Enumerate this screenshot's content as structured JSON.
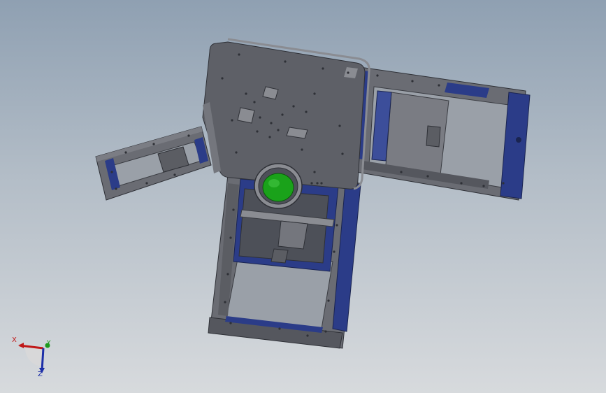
{
  "viewport": {
    "background_top": "#8fa0b2",
    "background_bottom": "#d7dadd"
  },
  "model": {
    "colors": {
      "plate_dark": "#5e6067",
      "plate_mid": "#74767d",
      "plate_light": "#8a8c92",
      "blue_accent": "#2b3c88",
      "lens_green": "#1aa21a",
      "edge": "#2e3036"
    }
  },
  "triad": {
    "x_label": "X",
    "y_label": "Y",
    "z_label": "Z",
    "x_color": "#c01818",
    "y_color": "#1c9a1c",
    "z_color": "#1c2ea8"
  }
}
